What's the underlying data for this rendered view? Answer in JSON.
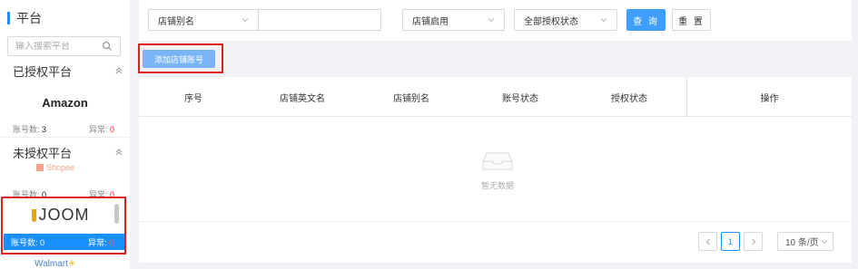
{
  "sidebar": {
    "title": "平台",
    "search_placeholder": "输入搜索平台",
    "authorized_header": "已授权平台",
    "unauthorized_header": "未授权平台",
    "account_label": "账号数:",
    "error_label": "异常:",
    "platforms": [
      {
        "name": "Amazon",
        "accounts": "3",
        "errors": "0"
      },
      {
        "name": "Shopee",
        "accounts": "0",
        "errors": "0"
      },
      {
        "name": "JOOM",
        "accounts": "0",
        "errors": "0",
        "selected": true
      },
      {
        "name": "Walmart"
      }
    ]
  },
  "filters": {
    "alias_select": "店铺别名",
    "alias_value": "",
    "enabled_select": "店铺启用",
    "auth_status_select": "全部授权状态",
    "query_button": "查 询",
    "reset_button": "重 置"
  },
  "actions": {
    "add_account_button": "添加店铺账号"
  },
  "table": {
    "columns": [
      "序号",
      "店铺英文名",
      "店铺别名",
      "账号状态",
      "授权状态",
      "操作"
    ],
    "rows": [],
    "empty_text": "暂无数据"
  },
  "pagination": {
    "current_page": "1",
    "page_size": "10 条/页"
  },
  "colors": {
    "primary": "#1890ff",
    "highlight_border": "#e02020",
    "error": "#f5222d"
  }
}
